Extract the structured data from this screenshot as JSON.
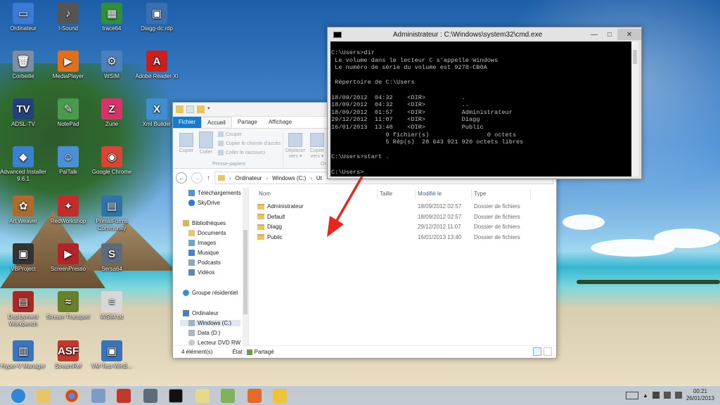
{
  "desktop": {
    "icons": [
      {
        "label": "Ordinateur",
        "color": "#3a7bd5",
        "glyph": "▭"
      },
      {
        "label": "I-Sound",
        "color": "#555555",
        "glyph": "♪"
      },
      {
        "label": "trace64",
        "color": "#2f8f3a",
        "glyph": "▦"
      },
      {
        "label": "Diagg-dc.rdp",
        "color": "#3a6fb0",
        "glyph": "▣"
      },
      {
        "label": "Corbeille",
        "color": "#7b8ea4",
        "glyph": "🗑"
      },
      {
        "label": "MediaPlayer",
        "color": "#e0701e",
        "glyph": "▶"
      },
      {
        "label": "WSIM",
        "color": "#4d7fbf",
        "glyph": "⚙"
      },
      {
        "label": "Adobe Reader XI",
        "color": "#c8201e",
        "glyph": "A"
      },
      {
        "label": "ADSL-TV",
        "color": "#23417a",
        "glyph": "TV"
      },
      {
        "label": "NotePad",
        "color": "#4a9a4e",
        "glyph": "✎"
      },
      {
        "label": "Zune",
        "color": "#d6336b",
        "glyph": "Z"
      },
      {
        "label": "Xml Builder",
        "color": "#3e8ed0",
        "glyph": "X"
      },
      {
        "label": "Advanced Installer 9.6.1",
        "color": "#3b7fcf",
        "glyph": "◆"
      },
      {
        "label": "PalTalk",
        "color": "#4a90d9",
        "glyph": "☺"
      },
      {
        "label": "Google Chrome",
        "color": "#d94434",
        "glyph": "◉"
      },
      {
        "label": "Art Weaver",
        "color": "#b06a2a",
        "glyph": "✿"
      },
      {
        "label": "RedWorkshop",
        "color": "#c42c2c",
        "glyph": "✦"
      },
      {
        "label": "PrimalForms Community",
        "color": "#2e74a8",
        "glyph": "▤"
      },
      {
        "label": "VBProject",
        "color": "#333333",
        "glyph": "▣"
      },
      {
        "label": "ScreenPresso",
        "color": "#b3232a",
        "glyph": "▶"
      },
      {
        "label": "Sersa64",
        "color": "#5d6b7a",
        "glyph": "S"
      },
      {
        "label": "Deployment Workbench",
        "color": "#a82828",
        "glyph": "▤"
      },
      {
        "label": "Stream Transport",
        "color": "#6a7f2a",
        "glyph": "≈"
      },
      {
        "label": "WSIM.txt",
        "color": "#d8d8d8",
        "glyph": "≡"
      },
      {
        "label": "Hyper-V Manager",
        "color": "#3a74b9",
        "glyph": "▥"
      },
      {
        "label": "StreamRef",
        "color": "#c0392b",
        "glyph": "ASF"
      },
      {
        "label": "VM-Test-WinB...",
        "color": "#3b73b8",
        "glyph": "▣"
      }
    ]
  },
  "explorer": {
    "ribbon_tabs": [
      "Fichier",
      "Accueil",
      "Partage",
      "Affichage"
    ],
    "ribbon": {
      "copier": "Copier",
      "coller": "Coller",
      "couper": "Couper",
      "copier_chemin": "Copier le chemin d'accès",
      "coller_raccourci": "Coller le raccourci",
      "deplacer": "Déplacer vers ▾",
      "copier_vers": "Copier vers ▾",
      "group_clipboard": "Presse-papiers",
      "group_org": "Or"
    },
    "address": [
      "Ordinateur",
      "Windows (C:)",
      "Ut"
    ],
    "nav": {
      "telechargements": "Téléchargements",
      "skydrive": "SkyDrive",
      "bibliotheques": "Bibliothèques",
      "documents": "Documents",
      "images": "Images",
      "musique": "Musique",
      "podcasts": "Podcasts",
      "videos": "Vidéos",
      "groupe": "Groupe résidentiel",
      "ordinateur": "Ordinateur",
      "windows_c": "Windows (C:)",
      "data_d": "Data (D:)",
      "dvd": "Lecteur DVD RW"
    },
    "columns": {
      "name": "Nom",
      "size": "Taille",
      "modified": "Modifié le",
      "type": "Type"
    },
    "rows": [
      {
        "name": "Administrateur",
        "date": "18/09/2012 02:57",
        "type": "Dossier de fichiers"
      },
      {
        "name": "Default",
        "date": "18/09/2012 02:57",
        "type": "Dossier de fichiers"
      },
      {
        "name": "Diagg",
        "date": "29/12/2012 11:07",
        "type": "Dossier de fichiers"
      },
      {
        "name": "Public",
        "date": "16/01/2013 13:40",
        "type": "Dossier de fichiers"
      }
    ],
    "status": {
      "count": "4 élément(s)",
      "state": "État :",
      "share": "Partagé"
    }
  },
  "cmd": {
    "title": "Administrateur : C:\\Windows\\system32\\cmd.exe",
    "lines": [
      "C:\\Users>dir",
      " Le volume dans le lecteur C s'appelle Windows",
      " Le numéro de série du volume est 9278-CB0A",
      "",
      " Répertoire de C:\\Users",
      "",
      "18/09/2012  04:32    <DIR>          .",
      "18/09/2012  04:32    <DIR>          ..",
      "18/09/2012  01:57    <DIR>          Administrateur",
      "29/12/2012  11:07    <DIR>          Diagg",
      "16/01/2013  13:40    <DIR>          Public",
      "               0 fichier(s)                0 octets",
      "               5 Rép(s)  28 643 921 920 octets libres",
      "",
      "C:\\Users>start .",
      "",
      "C:\\Users>"
    ]
  },
  "taskbar": {
    "time": "00:21",
    "date": "26/01/2013"
  }
}
